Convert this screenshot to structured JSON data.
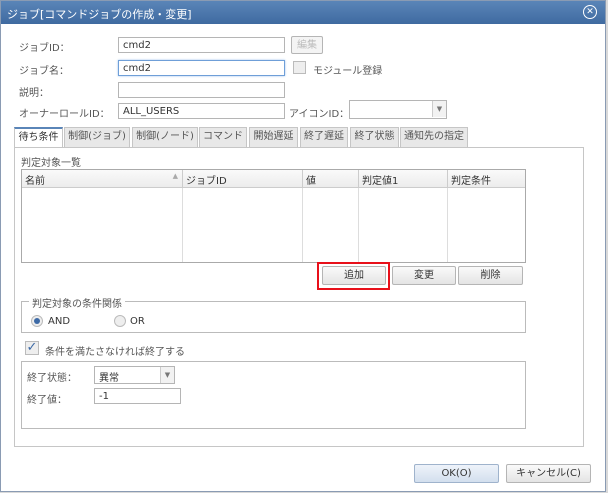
{
  "dialog": {
    "title": "ジョブ[コマンドジョブの作成・変更]",
    "close_icon": "close-circle-icon"
  },
  "form": {
    "job_id_label": "ジョブID：",
    "job_id_value": "cmd2",
    "edit_button": "編集",
    "job_name_label": "ジョブ名：",
    "job_name_value": "cmd2",
    "module_register_label": "モジュール登録",
    "module_register_checked": false,
    "description_label": "説明：",
    "description_value": "",
    "owner_role_label": "オーナーロールID：",
    "owner_role_value": "ALL_USERS",
    "icon_id_label": "アイコンID：",
    "icon_id_value": ""
  },
  "tabs": [
    {
      "label": "待ち条件",
      "active": true
    },
    {
      "label": "制御(ジョブ)"
    },
    {
      "label": "制御(ノード)"
    },
    {
      "label": "コマンド"
    },
    {
      "label": "開始遅延"
    },
    {
      "label": "終了遅延"
    },
    {
      "label": "終了状態"
    },
    {
      "label": "通知先の指定"
    }
  ],
  "wait": {
    "list_title": "判定対象一覧",
    "columns": [
      "名前",
      "ジョブID",
      "値",
      "判定値1",
      "判定条件"
    ],
    "rows": [],
    "add_button": "追加",
    "modify_button": "変更",
    "delete_button": "削除",
    "highlight_color": "#e8101a",
    "relation_legend": "判定対象の条件関係",
    "and_label": "AND",
    "or_label": "OR",
    "selected": "AND",
    "end_if_unmet_label": "条件を満たさなければ終了する",
    "end_if_unmet_checked": true,
    "end_status_label": "終了状態：",
    "end_status_value": "異常",
    "end_value_label": "終了値：",
    "end_value_value": "-1"
  },
  "footer": {
    "ok_button": "OK(O)",
    "cancel_button": "キャンセル(C)"
  }
}
